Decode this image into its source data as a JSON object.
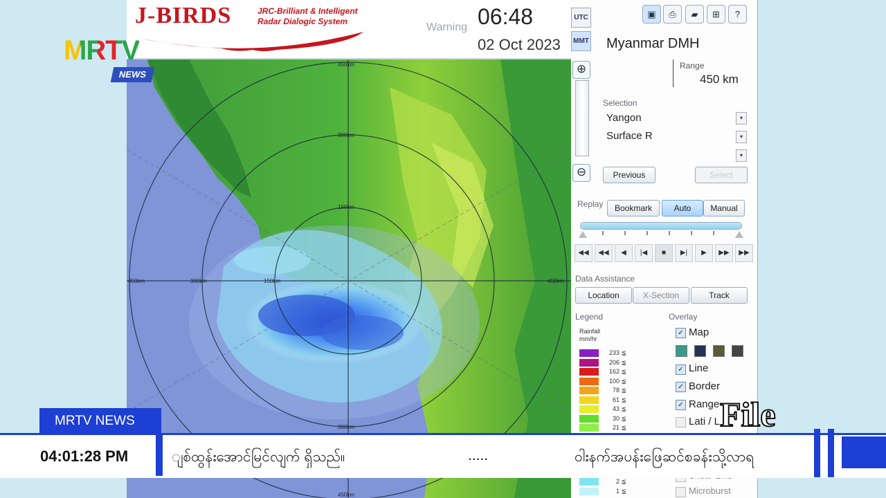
{
  "header": {
    "logo_title": "J-BIRDS",
    "logo_subtitle_line1": "JRC-Brilliant & Intelligent",
    "logo_subtitle_line2": "Radar Dialogic System",
    "warning_label": "Warning",
    "time": "06:48",
    "date": "02 Oct 2023",
    "tz_utc": "UTC",
    "tz_mmt": "MMT"
  },
  "toolbar": {
    "save_icon": "save-icon",
    "print_icon": "print-icon",
    "open_icon": "folder-open-icon",
    "export_icon": "export-icon",
    "help_icon": "help-icon"
  },
  "station": {
    "name": "Myanmar DMH",
    "range_label": "Range",
    "range_value": "450 km"
  },
  "selection": {
    "label": "Selection",
    "site": "Yangon",
    "product": "Surface R",
    "third": "",
    "previous_button": "Previous",
    "select_button": "Select"
  },
  "replay": {
    "label": "Replay",
    "bookmark_button": "Bookmark",
    "auto_button": "Auto",
    "manual_button": "Manual",
    "progress": 1.0
  },
  "data_assistance": {
    "label": "Data Assistance",
    "location_button": "Location",
    "xsection_button": "X-Section",
    "track_button": "Track"
  },
  "legend": {
    "label": "Legend",
    "title_line1": "Rainfall",
    "title_line2": "mm/hr",
    "items": [
      {
        "value": "233 ≦",
        "color": "#8a1fbf"
      },
      {
        "value": "206 ≦",
        "color": "#b0147f"
      },
      {
        "value": "162 ≦",
        "color": "#d61e1e"
      },
      {
        "value": "100 ≦",
        "color": "#ee6a10"
      },
      {
        "value": "78 ≦",
        "color": "#f3a51a"
      },
      {
        "value": "61 ≦",
        "color": "#f5d51c"
      },
      {
        "value": "43 ≦",
        "color": "#e8ee28"
      },
      {
        "value": "30 ≦",
        "color": "#5fdc27"
      },
      {
        "value": "21 ≦",
        "color": "#8fee4a"
      }
    ],
    "bottom_items": [
      {
        "value": "2 ≦",
        "color": "#7fe3ef"
      },
      {
        "value": "1 ≦",
        "color": "#bff3f8"
      }
    ]
  },
  "overlay": {
    "label": "Overlay",
    "map": "Map",
    "line": "Line",
    "border": "Border",
    "range": "Range",
    "latlon": "Lati / L",
    "shear_line": "Shear Line",
    "microburst": "Microburst"
  },
  "map_labels": {
    "r450_top": "450km",
    "r300_top": "300km",
    "r150_top": "150km",
    "r450_left": "450km",
    "r300_left": "300km",
    "r150_left": "150km",
    "r450_right": "450km",
    "r300_bottom": "300km",
    "r450_bottom": "450km"
  },
  "broadcast": {
    "brand": "MRTV",
    "news_tag": "NEWS",
    "file_label": "File",
    "ticker_tag": "MRTV NEWS",
    "ticker_time": "04:01:28  PM",
    "ticker_text_1": "ျစ်ထွန်းအောင်မြင်လျက် ရှိသည်။",
    "ticker_dots": ".....",
    "ticker_text_2": "ဝါးနက်အပန်းဖြေဆင်စခန်းသို့လာရ"
  },
  "colors": {
    "accent_blue": "#1d3fd4",
    "brand_red": "#c6161e"
  }
}
